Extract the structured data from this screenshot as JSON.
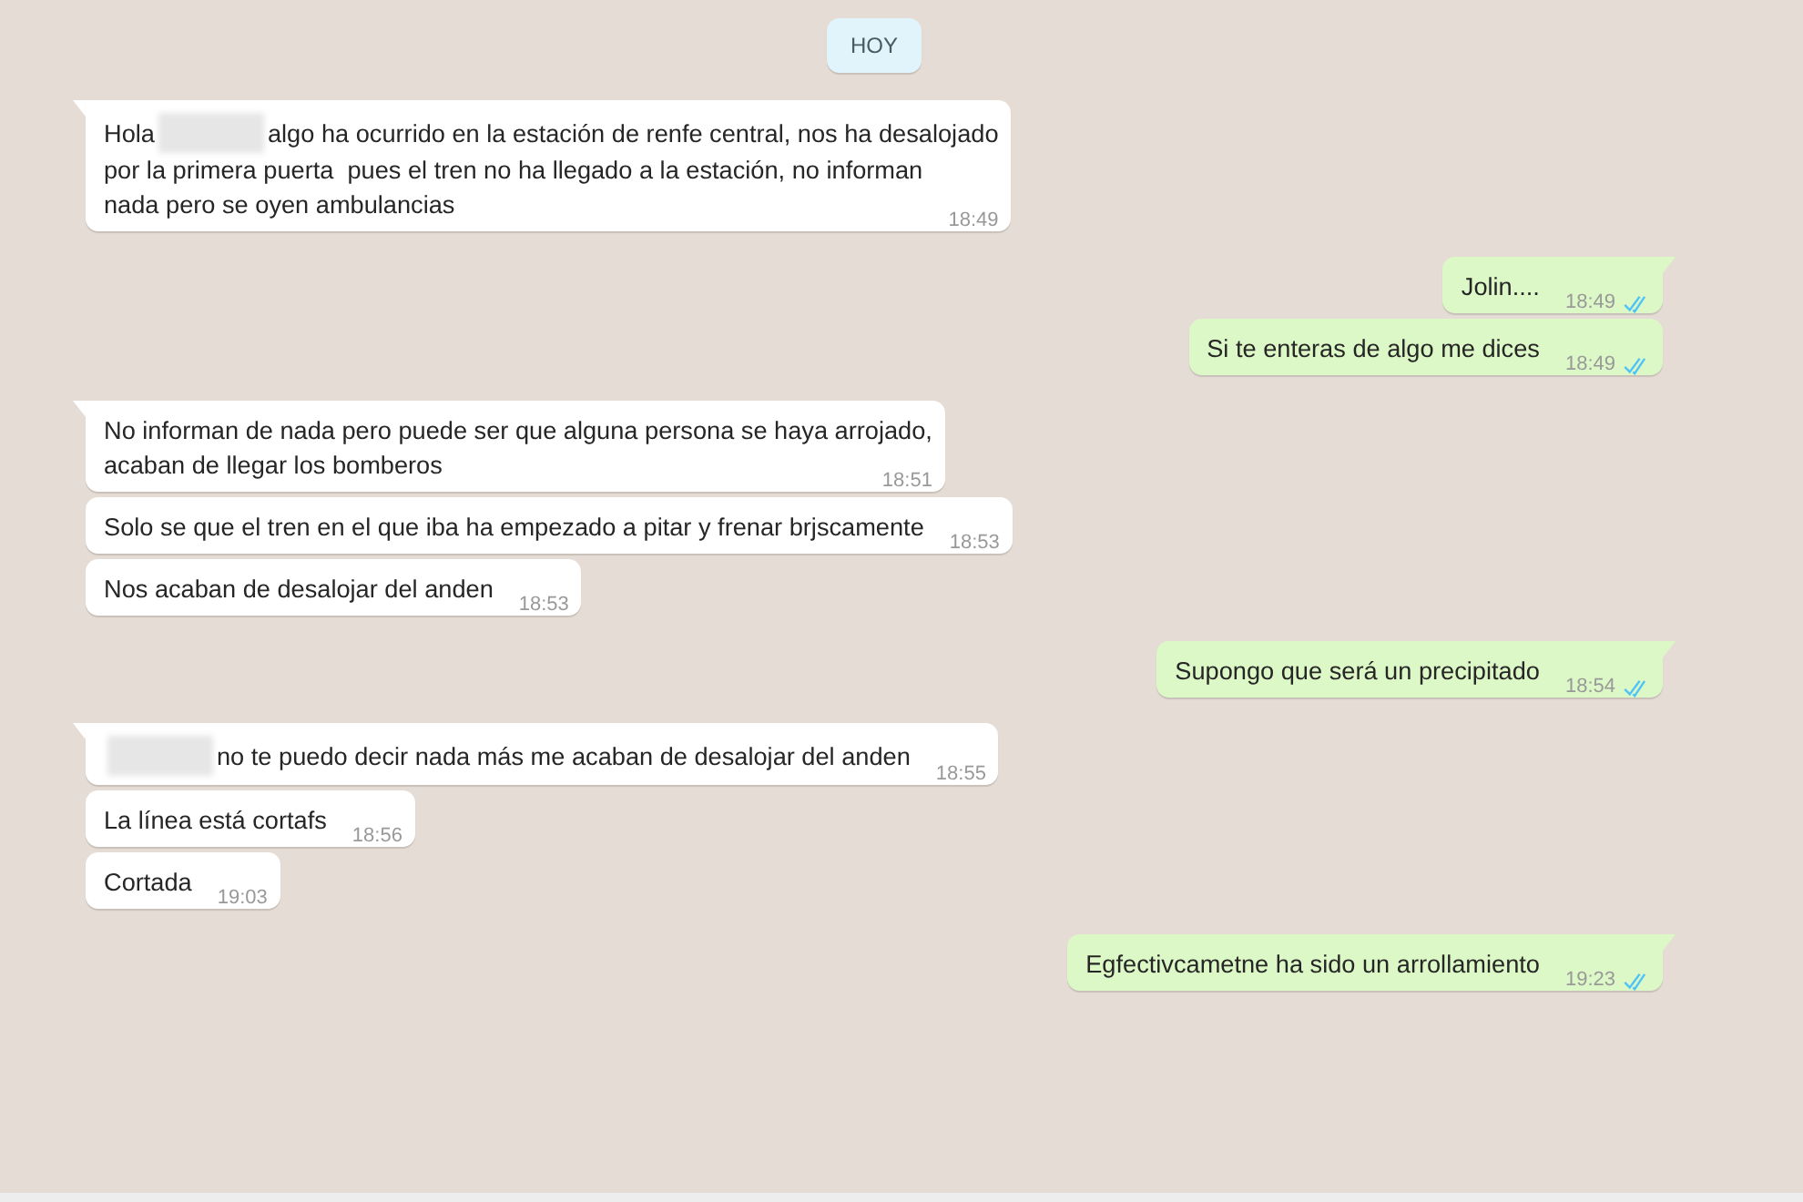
{
  "date_chip": "HOY",
  "messages": [
    {
      "kind": "incoming",
      "tail": true,
      "lines": [
        [
          {
            "kind": "text",
            "text": "Hola"
          },
          {
            "kind": "redaction"
          },
          {
            "kind": "text",
            "text": "algo ha ocurrido en la estación de renfe central, nos ha desalojado"
          }
        ],
        [
          {
            "kind": "text",
            "text": "por la primera puerta  pues el tren no ha llegado a la estación, no informan"
          }
        ],
        [
          {
            "kind": "text",
            "text": "nada pero se oyen ambulancias"
          }
        ]
      ],
      "time": "18:49"
    },
    {
      "kind": "outgoing",
      "tail": true,
      "lines": [
        [
          {
            "kind": "text",
            "text": "Jolin...."
          }
        ]
      ],
      "time": "18:49",
      "read": true
    },
    {
      "kind": "outgoing",
      "tail": false,
      "lines": [
        [
          {
            "kind": "text",
            "text": "Si te enteras de algo me dices"
          }
        ]
      ],
      "time": "18:49",
      "read": true
    },
    {
      "kind": "incoming",
      "tail": true,
      "lines": [
        [
          {
            "kind": "text",
            "text": "No informan de nada pero puede ser que alguna persona se haya arrojado,"
          }
        ],
        [
          {
            "kind": "text",
            "text": "acaban de llegar los bomberos"
          }
        ]
      ],
      "time": "18:51"
    },
    {
      "kind": "incoming",
      "tail": false,
      "lines": [
        [
          {
            "kind": "text",
            "text": "Solo se que el tren en el que iba ha empezado a pitar y frenar brjscamente"
          }
        ]
      ],
      "time": "18:53"
    },
    {
      "kind": "incoming",
      "tail": false,
      "lines": [
        [
          {
            "kind": "text",
            "text": "Nos acaban de desalojar del anden"
          }
        ]
      ],
      "time": "18:53"
    },
    {
      "kind": "outgoing",
      "tail": true,
      "lines": [
        [
          {
            "kind": "text",
            "text": "Supongo que será un precipitado"
          }
        ]
      ],
      "time": "18:54",
      "read": true
    },
    {
      "kind": "incoming",
      "tail": true,
      "lines": [
        [
          {
            "kind": "redaction"
          },
          {
            "kind": "text",
            "text": "no te puedo decir nada más me acaban de desalojar del anden"
          }
        ]
      ],
      "time": "18:55"
    },
    {
      "kind": "incoming",
      "tail": false,
      "lines": [
        [
          {
            "kind": "text",
            "text": "La línea está cortafs"
          }
        ]
      ],
      "time": "18:56"
    },
    {
      "kind": "incoming",
      "tail": false,
      "lines": [
        [
          {
            "kind": "text",
            "text": "Cortada"
          }
        ]
      ],
      "time": "19:03"
    },
    {
      "kind": "outgoing",
      "tail": true,
      "lines": [
        [
          {
            "kind": "text",
            "text": "Egfectivcametne ha sido un arrollamiento"
          }
        ]
      ],
      "time": "19:23",
      "read": true
    }
  ]
}
